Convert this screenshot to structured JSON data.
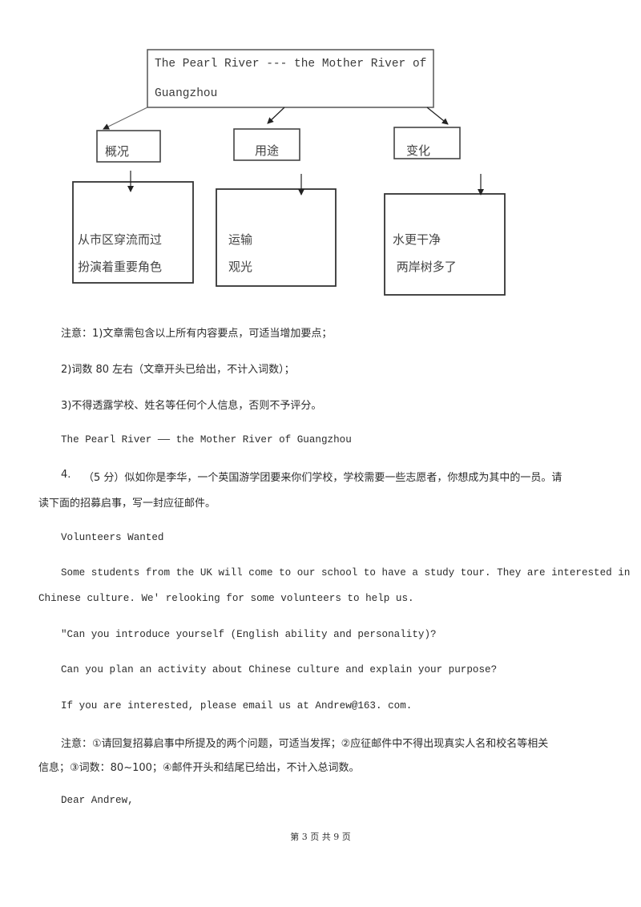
{
  "diagram": {
    "title_line1": "The Pearl River --- the Mother River of",
    "title_line2": "Guangzhou",
    "categories": [
      {
        "label": "概况",
        "details": [
          "从市区穿流而过",
          "扮演着重要角色"
        ]
      },
      {
        "label": "用途",
        "details": [
          "运输",
          "观光"
        ]
      },
      {
        "label": "变化",
        "details": [
          "水更干净",
          " 两岸树多了"
        ]
      }
    ]
  },
  "notes": {
    "line1": "注意：1)文章需包含以上所有内容要点，可适当增加要点；",
    "line2": "2)词数 80 左右（文章开头已给出，不计入词数）；",
    "line3": "3)不得透露学校、姓名等任何个人信息，否则不予评分。",
    "essay_opening": "The Pearl River —— the Mother River of Guangzhou"
  },
  "question4": {
    "number": "4.",
    "prompt_line1": "（5 分）似如你是李华，一个英国游学团要来你们学校，学校需要一些志愿者，你想成为其中的一员。请",
    "prompt_line2": "读下面的招募启事，写一封应征邮件。",
    "notice_title": "Volunteers Wanted",
    "notice_body_line1": "Some students from the UK will come to our school to have a study tour. They are interested in",
    "notice_body_line2": "Chinese culture. We' relooking for some volunteers to help us.",
    "question_a": "\"Can you introduce yourself (English ability and personality)?",
    "question_b": "Can you plan an activity about Chinese culture and explain your purpose?",
    "contact": "If you are interested, please email us at Andrew@163. com.",
    "note_line1": "注意：①请回复招募启事中所提及的两个问题，可适当发挥；②应征邮件中不得出现真实人名和校名等相关",
    "note_line2": "信息；③词数：80~100；④邮件开头和结尾已给出，不计入总词数。",
    "salutation": "Dear Andrew,"
  },
  "footer": {
    "page_indicator": "第 3 页 共 9 页"
  }
}
